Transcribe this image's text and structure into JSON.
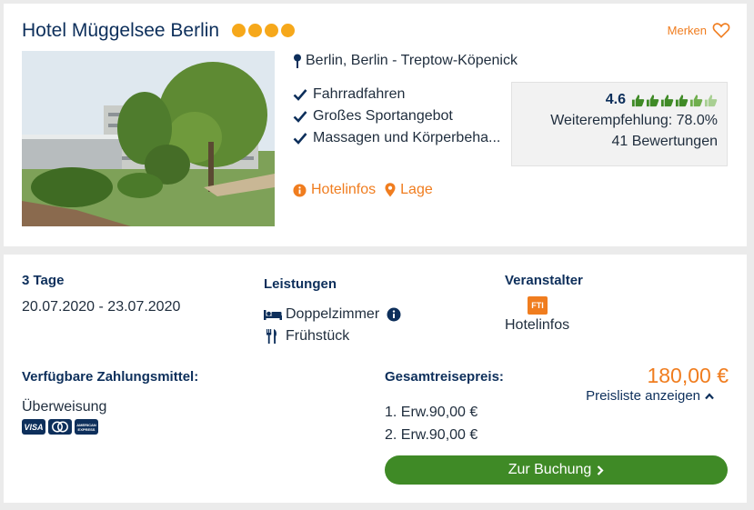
{
  "hotel": {
    "name": "Hotel Müggelsee Berlin",
    "stars": 4,
    "merken_label": "Merken",
    "location": "Berlin, Berlin - Treptow-Köpenick",
    "features": [
      "Fahrradfahren",
      "Großes Sportangebot",
      "Massagen und Körperbeha..."
    ],
    "rating": {
      "score": "4.6",
      "thumbs_filled": 4.6,
      "thumbs_total": 6,
      "recommendation": "Weiterempfehlung: 78.0%",
      "reviews": "41 Bewertungen"
    },
    "links": {
      "hotelinfos": "Hotelinfos",
      "lage": "Lage"
    }
  },
  "offer": {
    "duration": "3 Tage",
    "dates": "20.07.2020 - 23.07.2020",
    "services_title": "Leistungen",
    "room": "Doppelzimmer",
    "board": "Frühstück",
    "organizer_title": "Veranstalter",
    "organizer_logo_text": "FTI",
    "organizer_link": "Hotelinfos",
    "payment_title": "Verfügbare Zahlungsmittel:",
    "payment_method": "Überweisung",
    "payment_cards": [
      "VISA",
      "mastercard",
      "AMERICAN EXPRESS"
    ],
    "total_title": "Gesamtreisepreis:",
    "price": "180,00 €",
    "pricelist_label": "Preisliste anzeigen",
    "persons": [
      "1. Erw.90,00 €",
      "2. Erw.90,00 €"
    ],
    "book_label": "Zur Buchung"
  },
  "colors": {
    "accent": "#f07d1f",
    "navy": "#0d2f5b",
    "green": "#3f8a26",
    "star": "#f6a81b"
  }
}
